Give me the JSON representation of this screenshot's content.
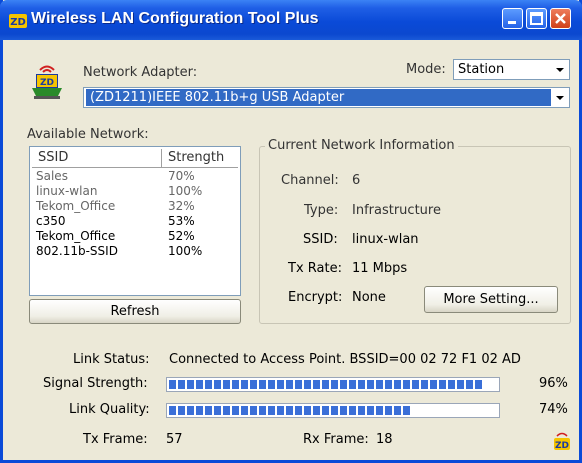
{
  "window": {
    "title": "Wireless LAN Configuration Tool Plus"
  },
  "adapter": {
    "label": "Network Adapter:",
    "value": "(ZD1211)IEEE 802.11b+g USB Adapter"
  },
  "mode": {
    "label": "Mode:",
    "value": "Station"
  },
  "available": {
    "label": "Available Network:",
    "columns": [
      "SSID",
      "Strength"
    ],
    "rows": [
      {
        "ssid": "Sales",
        "strength": "70%"
      },
      {
        "ssid": "linux-wlan",
        "strength": "100%"
      },
      {
        "ssid": "Tekom_Office",
        "strength": "32%"
      },
      {
        "ssid": "c350",
        "strength": "53%"
      },
      {
        "ssid": "Tekom_Office",
        "strength": "52%"
      },
      {
        "ssid": "802.11b-SSID",
        "strength": "100%"
      }
    ],
    "refresh": "Refresh"
  },
  "current": {
    "title": "Current Network Information",
    "channel_label": "Channel:",
    "channel_value": "6",
    "type_label": "Type:",
    "type_value": "Infrastructure",
    "ssid_label": "SSID:",
    "ssid_value": "linux-wlan",
    "txrate_label": "Tx Rate:",
    "txrate_value": "11 Mbps",
    "encrypt_label": "Encrypt:",
    "encrypt_value": "None",
    "more_button": "More Setting..."
  },
  "status": {
    "link_label": "Link Status:",
    "link_value": "Connected to Access Point. BSSID=00 02 72 F1 02 AD",
    "signal_label": "Signal Strength:",
    "signal_percent": "96%",
    "signal_value": 0.96,
    "quality_label": "Link Quality:",
    "quality_percent": "74%",
    "quality_value": 0.74,
    "tx_label": "Tx Frame:",
    "tx_value": "57",
    "rx_label": "Rx Frame:",
    "rx_value": "18"
  },
  "colors": {
    "titlebar": "#0a4ad8",
    "selection": "#316ac5",
    "progress": "#3a6fd8"
  }
}
